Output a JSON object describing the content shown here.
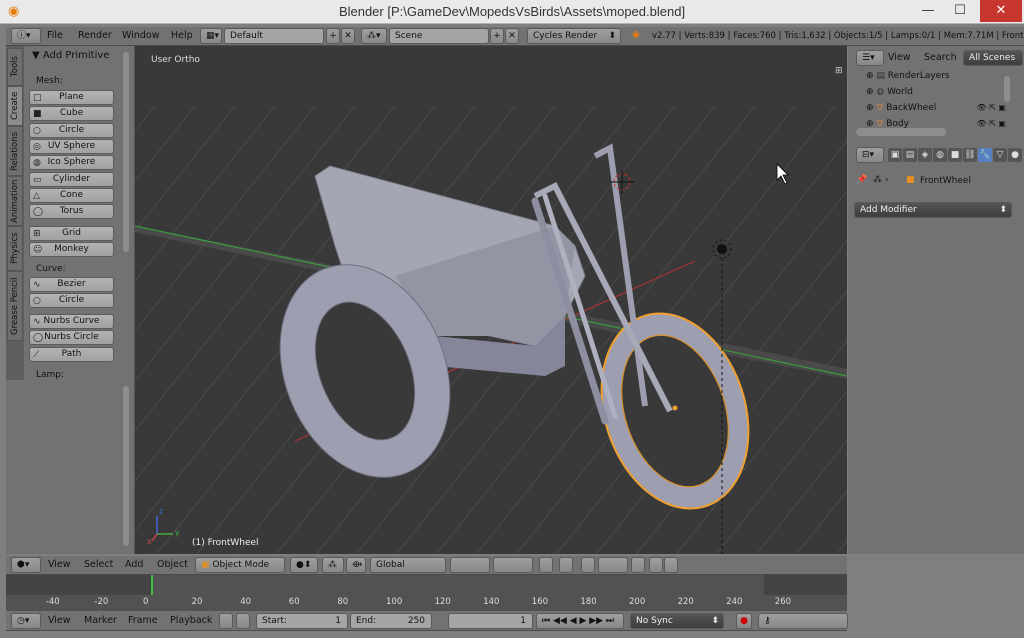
{
  "window": {
    "title": "Blender [P:\\GameDev\\MopedsVsBirds\\Assets\\moped.blend]",
    "minimize": "—",
    "maximize": "☐",
    "close": "✕"
  },
  "info_header": {
    "menus": [
      "File",
      "Render",
      "Window",
      "Help"
    ],
    "layout": "Default",
    "scene": "Scene",
    "engine": "Cycles Render",
    "stats": "v2.77 | Verts:839 | Faces:760 | Tris:1,632 | Objects:1/5 | Lamps:0/1 | Mem:7.71M | Front"
  },
  "tool_shelf": {
    "tabs": [
      "Tools",
      "Create",
      "Relations",
      "Animation",
      "Physics",
      "Grease Pencil"
    ],
    "panel_title": "Add Primitive",
    "mesh_label": "Mesh:",
    "mesh_items": [
      "Plane",
      "Cube",
      "Circle",
      "UV Sphere",
      "Ico Sphere",
      "Cylinder",
      "Cone",
      "Torus"
    ],
    "mesh_items2": [
      "Grid",
      "Monkey"
    ],
    "curve_label": "Curve:",
    "curve_items": [
      "Bezier",
      "Circle"
    ],
    "curve_items2": [
      "Nurbs Curve",
      "Nurbs Circle",
      "Path"
    ],
    "lamp_label": "Lamp:"
  },
  "viewport": {
    "view_name": "User Ortho",
    "object_label": "(1) FrontWheel",
    "axis_x": "x",
    "axis_y": "y",
    "axis_z": "z"
  },
  "view3d_header": {
    "menus": [
      "View",
      "Select",
      "Add",
      "Object"
    ],
    "mode": "Object Mode",
    "orientation": "Global"
  },
  "outliner": {
    "menus": [
      "View",
      "Search"
    ],
    "filter": "All Scenes",
    "items": [
      {
        "label": "RenderLayers",
        "icon": "render-layers-icon"
      },
      {
        "label": "World",
        "icon": "world-icon"
      },
      {
        "label": "BackWheel",
        "icon": "object-icon"
      },
      {
        "label": "Body",
        "icon": "object-icon"
      }
    ]
  },
  "properties": {
    "object_name": "FrontWheel",
    "add_modifier": "Add Modifier"
  },
  "timeline": {
    "ticks": [
      "-40",
      "-20",
      "0",
      "20",
      "40",
      "60",
      "80",
      "100",
      "120",
      "140",
      "160",
      "180",
      "200",
      "220",
      "240",
      "260"
    ],
    "current_frame": 0
  },
  "timeline_header": {
    "menus": [
      "View",
      "Marker",
      "Frame",
      "Playback"
    ],
    "start_label": "Start:",
    "start_value": "1",
    "end_label": "End:",
    "end_value": "250",
    "current": "1",
    "sync": "No Sync"
  },
  "colors": {
    "selection": "#f0a030",
    "viewport_bg": "#393939",
    "x_axis": "#b03030",
    "y_axis": "#40a040"
  }
}
